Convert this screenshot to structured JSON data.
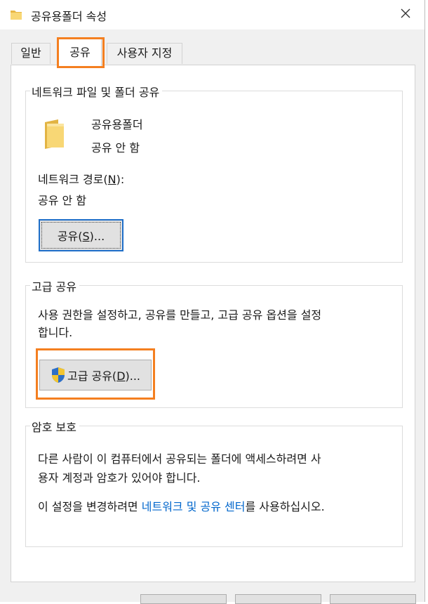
{
  "window": {
    "title": "공유용폴더 속성",
    "close_glyph": "✕"
  },
  "tabs": [
    {
      "label": "일반"
    },
    {
      "label": "공유"
    },
    {
      "label": "사용자 지정"
    }
  ],
  "network_sharing": {
    "group_title": "네트워크 파일 및 폴더 공유",
    "folder_name": "공유용폴더",
    "folder_status": "공유 안 함",
    "path_label_pre": "네트워크 경로(",
    "path_label_key": "N",
    "path_label_post": "):",
    "path_value": "공유 안 함",
    "share_button_pre": "공유(",
    "share_button_key": "S",
    "share_button_post": ")..."
  },
  "advanced_sharing": {
    "group_title": "고급 공유",
    "description_line1": "사용 권한을 설정하고, 공유를 만들고, 고급 공유 옵션을 설정",
    "description_line2": "합니다.",
    "button_pre": "고급 공유(",
    "button_key": "D",
    "button_post": ")..."
  },
  "password_protection": {
    "group_title": "암호 보호",
    "line1": "다른 사람이 이 컴퓨터에서 공유되는 폴더에 액세스하려면 사",
    "line2": "용자 계정과 암호가 있어야 합니다.",
    "line3_pre": "이 설정을 변경하려면 ",
    "line3_link": "네트워크 및 공유 센터",
    "line3_post": "를 사용하십시오."
  },
  "colors": {
    "highlight": "#f47f20",
    "link": "#0066cc",
    "focus_border": "#1e6ec8",
    "folder_yellow": "#f8d775"
  }
}
